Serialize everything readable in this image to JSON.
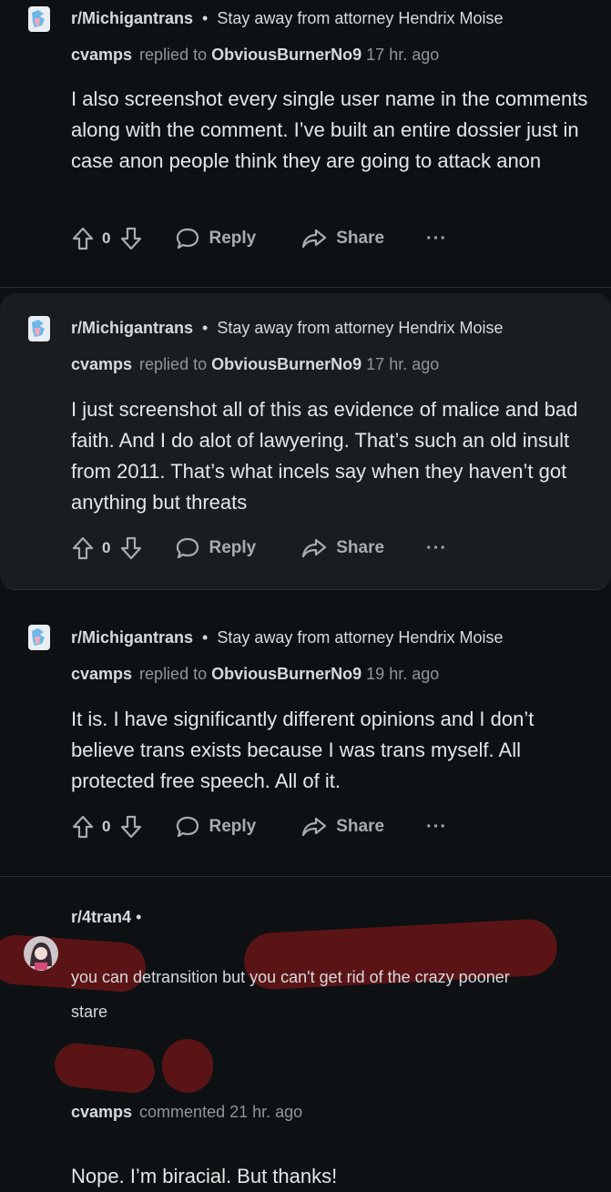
{
  "comments": [
    {
      "subreddit": "r/Michigantrans",
      "post_title": "Stay away from attorney Hendrix Moise",
      "user": "cvamps",
      "action": "replied to",
      "target": "ObviousBurnerNo9",
      "time": "17 hr. ago",
      "body": "I also screenshot every single user name in the comments along with the comment. I’ve built an entire dossier just in case anon people think they are going to attack anon",
      "votes": "0",
      "reply_label": "Reply",
      "share_label": "Share",
      "more_label": "···"
    },
    {
      "subreddit": "r/Michigantrans",
      "post_title": "Stay away from attorney Hendrix Moise",
      "user": "cvamps",
      "action": "replied to",
      "target": "ObviousBurnerNo9",
      "time": "17 hr. ago",
      "body": "I just screenshot all of this as evidence of malice and bad faith. And I do alot of lawyering. That’s such an old insult from 2011. That’s what incels say when they haven’t got anything but threats",
      "votes": "0",
      "reply_label": "Reply",
      "share_label": "Share",
      "more_label": "···"
    },
    {
      "subreddit": "r/Michigantrans",
      "post_title": "Stay away from attorney Hendrix Moise",
      "user": "cvamps",
      "action": "replied to",
      "target": "ObviousBurnerNo9",
      "time": "19 hr. ago",
      "body": "It is. I have significantly different opinions and I don’t believe trans exists because I was trans myself. All protected free speech. All of it.",
      "votes": "0",
      "reply_label": "Reply",
      "share_label": "Share",
      "more_label": "···"
    }
  ],
  "last": {
    "subreddit": "r/4tran4",
    "dot": "•",
    "parent_text_line1": "you can detransition but you can't get rid of the crazy pooner",
    "parent_text_line2": "stare",
    "user": "cvamps",
    "action": "commented",
    "time": "21 hr. ago",
    "body": "Nope. I’m biracial. But thanks!"
  },
  "dot": "•",
  "colors": {
    "background": "#0e1113",
    "highlight_card": "#1a1d20",
    "scribble": "#5b1416"
  }
}
